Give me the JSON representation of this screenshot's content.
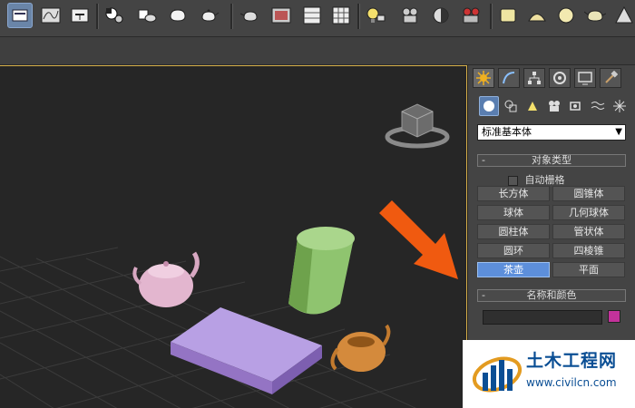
{
  "toolbar": {
    "icons": [
      "layer-icon",
      "curve-editor-icon",
      "schematic-icon",
      "material-editor-icon",
      "render-setup-icon",
      "rendered-frame-icon",
      "render-icon",
      "teapot-render-icon",
      "teapot-icon",
      "camera-icon",
      "tv-icon",
      "grid-icon",
      "table-icon",
      "light-icon",
      "camera-view-icon",
      "camera-orbit-icon",
      "video-camera-icon",
      "rectangle-icon",
      "dome-icon",
      "sphere-icon",
      "teapot-small-icon",
      "cone-icon"
    ]
  },
  "panel": {
    "dropdown_value": "标准基本体",
    "object_type": {
      "header": "对象类型",
      "autogrid_label": "自动栅格",
      "buttons": [
        "长方体",
        "圆锥体",
        "球体",
        "几何球体",
        "圆柱体",
        "管状体",
        "圆环",
        "四棱锥",
        "茶壶",
        "平面"
      ],
      "active_button": "茶壶"
    },
    "name_color": {
      "header": "名称和颜色",
      "name_value": "",
      "color": "#c3329b"
    }
  },
  "watermark": {
    "title": "土木工程网",
    "url": "www.civilcn.com"
  },
  "colors": {
    "arrow": "#f05a10",
    "box": "#a98ad4",
    "cylinder": "#8fc46f",
    "teapot_pink": "#e3b6cf",
    "teapot_orange": "#d48a3c",
    "active_button": "#5d8fdb"
  }
}
